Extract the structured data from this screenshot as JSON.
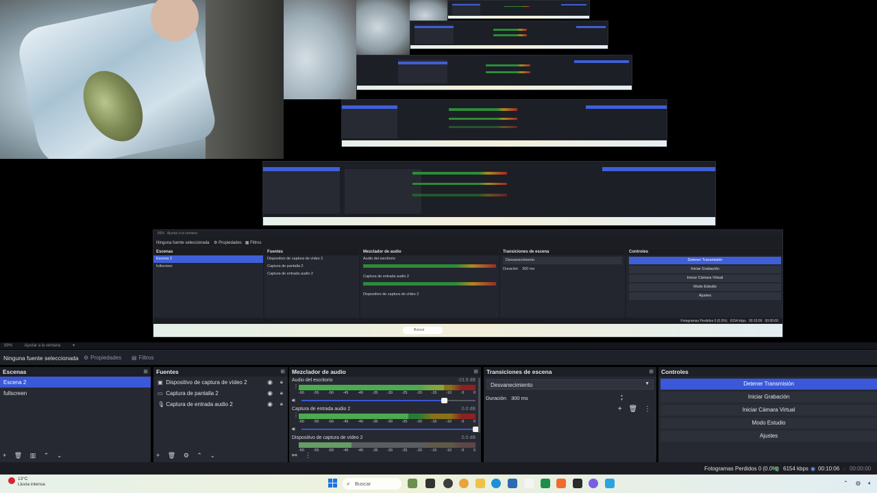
{
  "zoom": {
    "value": "89%",
    "fit_label": "Ajustar a la ventana"
  },
  "source_toolbar": {
    "no_source": "Ninguna fuente seleccionada",
    "properties": "Propiedades",
    "filters": "Filtros"
  },
  "scenes": {
    "title": "Escenas",
    "items": [
      "Escena 2",
      "fullscreen"
    ],
    "selected": "Escena 2"
  },
  "sources": {
    "title": "Fuentes",
    "items": [
      {
        "name": "Dispositivo de captura de vídeo 2",
        "icon": "camera-icon"
      },
      {
        "name": "Captura de pantalla 2",
        "icon": "monitor-icon"
      },
      {
        "name": "Captura de entrada audio 2",
        "icon": "microphone-icon"
      }
    ]
  },
  "mixer": {
    "title": "Mezclador de audio",
    "ticks": [
      "-60",
      "-55",
      "-50",
      "-45",
      "-40",
      "-35",
      "-30",
      "-25",
      "-20",
      "-15",
      "-10",
      "-5",
      "0"
    ],
    "channels": [
      {
        "name": "Audio del escritorio",
        "db": "-23.9 dB",
        "level": 0.82,
        "volume": 0.82,
        "active": true
      },
      {
        "name": "Captura de entrada audio 2",
        "db": "0.0 dB",
        "level": 0.62,
        "volume": 1.0,
        "active": true
      },
      {
        "name": "Dispositivo de captura de vídeo 2",
        "db": "0.0 dB",
        "level": 0.3,
        "volume": 1.0,
        "active": false
      }
    ]
  },
  "transitions": {
    "title": "Transiciones de escena",
    "selected": "Desvanecimiento",
    "duration_label": "Duración",
    "duration_value": "300 ms"
  },
  "controls": {
    "title": "Controles",
    "buttons": [
      "Detener Transmisión",
      "Iniciar Grabación",
      "Iniciar Cámara Virtual",
      "Modo Estudio",
      "Ajustes"
    ],
    "active": "Detener Transmisión"
  },
  "status": {
    "dropped": "Fotogramas Perdidos 0 (0.0%)",
    "bitrate": "6154 kbps",
    "live_time": "00:10:06",
    "rec_time": "00:00:00"
  },
  "taskbar": {
    "weather_temp": "13°C",
    "weather_desc": "Lluvia intensa",
    "search_placeholder": "Buscar"
  },
  "colors": {
    "accent": "#3a58d8",
    "panel": "#262931",
    "meter_green": "#2a7a35",
    "meter_yellow": "#8a7317",
    "meter_red": "#8c2222"
  }
}
